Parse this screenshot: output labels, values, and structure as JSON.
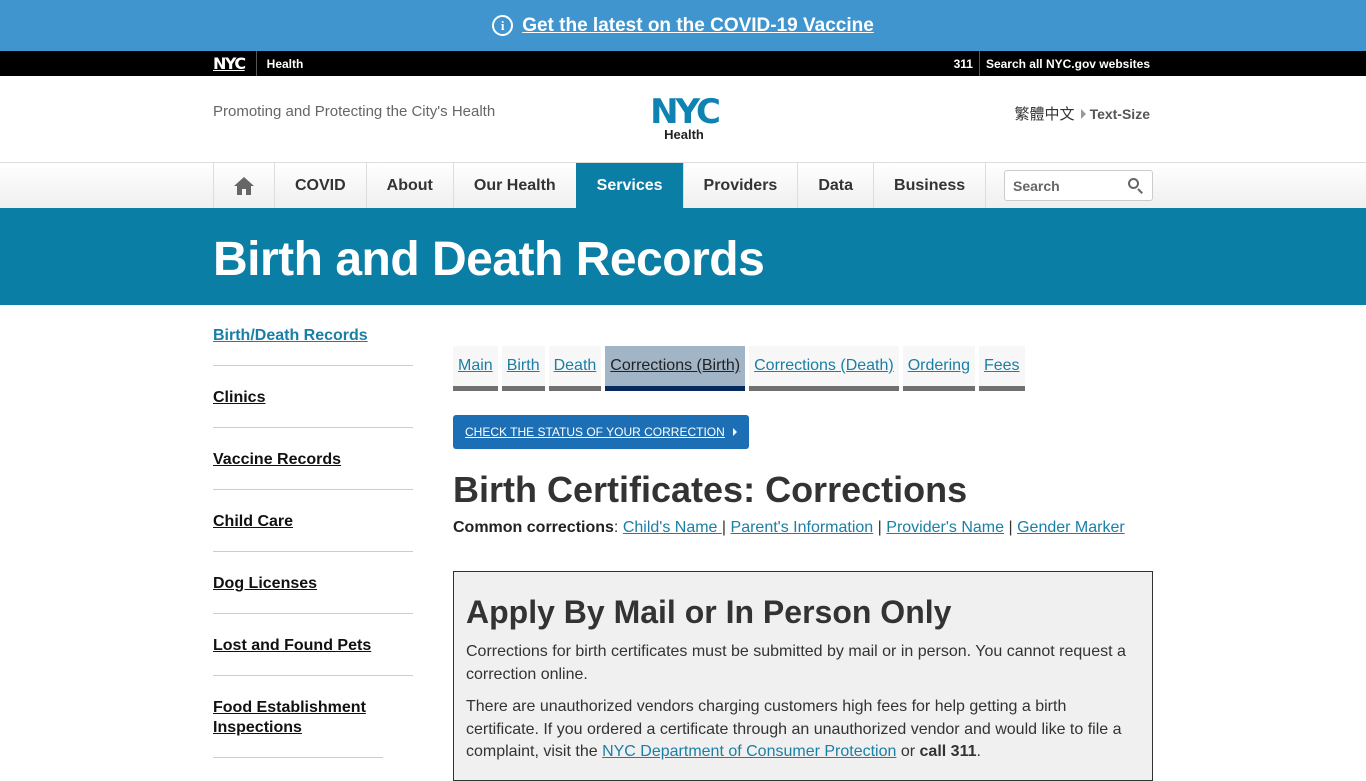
{
  "alert": {
    "icon": "info-icon",
    "link_text": "Get the latest on the COVID-19 Vaccine"
  },
  "util_bar": {
    "logo_text": "NYC",
    "agency_link": "Health",
    "phone_link": "311",
    "search_link": "Search all NYC.gov websites"
  },
  "header": {
    "tagline": "Promoting and Protecting the City's Health",
    "logo_text": "NYC",
    "logo_subtitle": "Health",
    "language_link": "繁體中文",
    "text_size_link": "Text-Size"
  },
  "nav": {
    "home_icon": "home-icon",
    "items": [
      {
        "label": "COVID",
        "active": false
      },
      {
        "label": "About",
        "active": false
      },
      {
        "label": "Our Health",
        "active": false
      },
      {
        "label": "Services",
        "active": true
      },
      {
        "label": "Providers",
        "active": false
      },
      {
        "label": "Data",
        "active": false
      },
      {
        "label": "Business",
        "active": false
      }
    ],
    "search": {
      "placeholder": "Search",
      "value": "",
      "icon": "search-icon"
    }
  },
  "title_band": {
    "title": "Birth and Death Records"
  },
  "sidebar": {
    "items": [
      {
        "label": "Birth/Death Records",
        "current": true
      },
      {
        "label": "Clinics",
        "current": false
      },
      {
        "label": "Vaccine Records",
        "current": false
      },
      {
        "label": "Child Care",
        "current": false
      },
      {
        "label": "Dog Licenses",
        "current": false
      },
      {
        "label": "Lost and Found Pets",
        "current": false
      },
      {
        "label": "Food Establishment Inspections",
        "current": false
      }
    ]
  },
  "subtabs": {
    "items": [
      {
        "label": "Main",
        "active": false
      },
      {
        "label": "Birth",
        "active": false
      },
      {
        "label": "Death",
        "active": false
      },
      {
        "label": "Corrections (Birth)",
        "active": true
      },
      {
        "label": "Corrections (Death)",
        "active": false
      },
      {
        "label": "Ordering",
        "active": false
      },
      {
        "label": "Fees",
        "active": false
      }
    ]
  },
  "main": {
    "status_button": "CHECK THE STATUS OF YOUR CORRECTION",
    "heading": "Birth Certificates: Corrections",
    "common_label": "Common corrections",
    "common_links": [
      "Child's Name ",
      "Parent's Information",
      "Provider's Name",
      "Gender Marker"
    ],
    "separator": "|"
  },
  "notice": {
    "heading": "Apply By Mail or In Person Only",
    "para1": "Corrections for birth certificates must be submitted by mail or in person. You cannot request a correction online.",
    "para2_before": "There are unauthorized vendors charging customers high fees for help getting a birth certificate. If you ordered a certificate through an unauthorized vendor and would like to file a complaint, visit the ",
    "para2_link": "NYC Department of Consumer Protection",
    "para2_middle": " or ",
    "para2_bold": "call 311",
    "para2_end": "."
  },
  "colors": {
    "alert_bg": "#4095cf",
    "brand_teal": "#0a7ea4",
    "link": "#1a7fa6",
    "active_subtab_bg": "#a1b5c6",
    "active_subtab_bar": "#062a5b",
    "button_blue": "#1d6fb5"
  }
}
